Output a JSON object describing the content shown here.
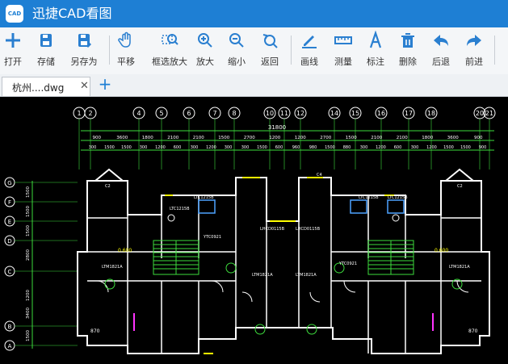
{
  "app": {
    "title": "迅捷CAD看图",
    "logo": "CAD"
  },
  "toolbar": {
    "open": "打开",
    "save": "存储",
    "save_as": "另存为",
    "pan": "平移",
    "zoom_window": "框选放大",
    "zoom_in": "放大",
    "zoom_out": "缩小",
    "back": "返回",
    "line": "画线",
    "measure": "测量",
    "annotate": "标注",
    "delete": "删除",
    "undo": "后退",
    "redo": "前进"
  },
  "tabs": [
    {
      "label": "杭州....dwg"
    }
  ],
  "drawing": {
    "axis_top": [
      "1",
      "2",
      "4",
      "5",
      "6",
      "7",
      "8",
      "10",
      "11",
      "12",
      "14",
      "15",
      "16",
      "17",
      "18",
      "20",
      "21"
    ],
    "axis_left": [
      "G",
      "F",
      "E",
      "D",
      "C",
      "B",
      "A"
    ],
    "total_dim": "31800",
    "dims_row1": [
      "900",
      "3600",
      "1800",
      "2100",
      "2100",
      "1500",
      "2700",
      "1200",
      "1200",
      "2700",
      "1500",
      "2100",
      "2100",
      "1800",
      "3600",
      "900"
    ],
    "dims_row2": [
      "300",
      "1500",
      "1500",
      "300",
      "1200",
      "600",
      "300",
      "1200",
      "300",
      "300",
      "1500",
      "600",
      "960",
      "980",
      "1500",
      "880",
      "300",
      "1200",
      "600",
      "300",
      "1200",
      "1500",
      "1500",
      "900"
    ],
    "dims_left": [
      "1500",
      "1500",
      "1500",
      "2800",
      "1200",
      "3400",
      "1500"
    ],
    "labels": {
      "ltc1215b": "LTC1215B",
      "lhcd0115b": "LHCD0115B",
      "ltm1821a": "LTM1821A",
      "ytc0921": "YTC0921",
      "c2": "C2",
      "c4": "C4",
      "level1": "0.600",
      "level2": "0.600",
      "dim870": "870"
    }
  }
}
